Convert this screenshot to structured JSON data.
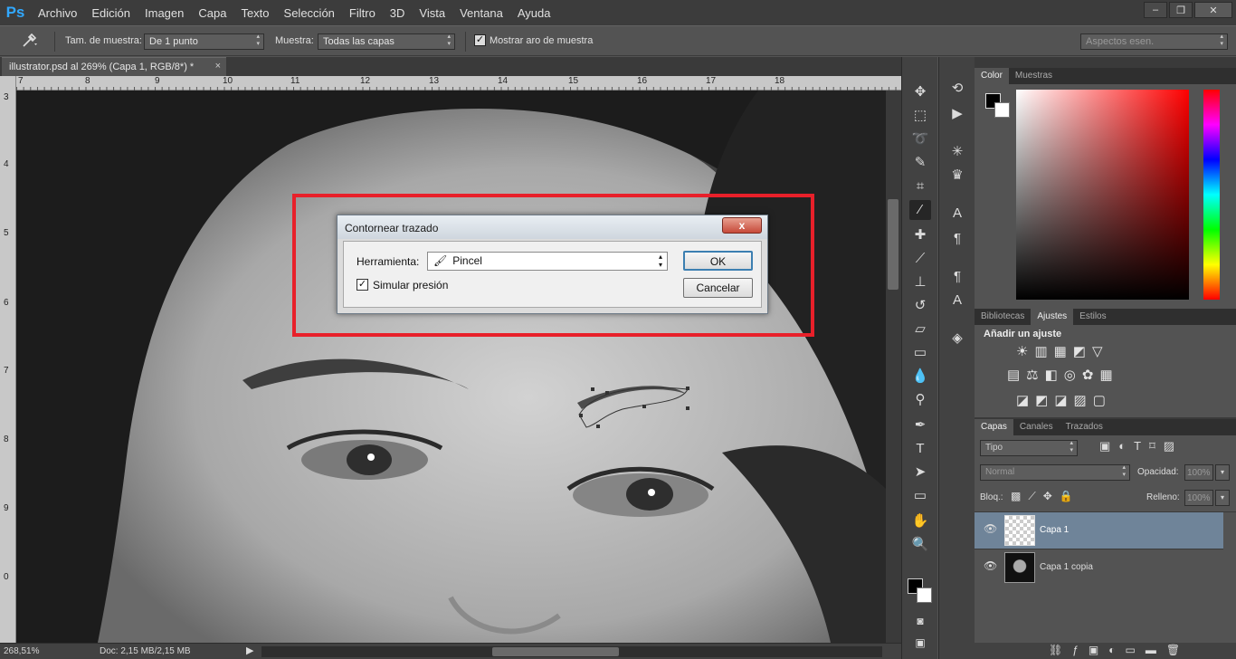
{
  "app": {
    "logo": "Ps"
  },
  "menu": [
    "Archivo",
    "Edición",
    "Imagen",
    "Capa",
    "Texto",
    "Selección",
    "Filtro",
    "3D",
    "Vista",
    "Ventana",
    "Ayuda"
  ],
  "window_controls": [
    "–",
    "❐",
    "✕"
  ],
  "options": {
    "sample_size_label": "Tam. de muestra:",
    "sample_size_value": "De 1 punto",
    "sample_label": "Muestra:",
    "sample_value": "Todas las capas",
    "show_ring_label": "Mostrar aro de muestra",
    "workspace": "Aspectos esen."
  },
  "document": {
    "tab": "illustrator.psd al 269% (Capa 1, RGB/8*) *",
    "zoom": "268,51%",
    "doc_info": "Doc: 2,15 MB/2,15 MB"
  },
  "rulers": {
    "h": [
      "7",
      "8",
      "9",
      "10",
      "11",
      "12",
      "13",
      "14",
      "15",
      "16",
      "17",
      "18"
    ],
    "v": [
      "3",
      "4",
      "5",
      "6",
      "7",
      "8",
      "9",
      "0"
    ]
  },
  "dialog": {
    "title": "Contornear trazado",
    "close": "x",
    "tool_label": "Herramienta:",
    "tool_value": "Pincel",
    "simulate_label": "Simular presión",
    "simulate_checked": true,
    "ok": "OK",
    "cancel": "Cancelar"
  },
  "panels": {
    "color_tabs": [
      "Color",
      "Muestras"
    ],
    "adjust_tabs": [
      "Bibliotecas",
      "Ajustes",
      "Estilos"
    ],
    "adjust_title": "Añadir un ajuste",
    "layers_tabs": [
      "Capas",
      "Canales",
      "Trazados"
    ],
    "filter_kind": "Tipo",
    "blend_mode": "Normal",
    "opacity_label": "Opacidad:",
    "opacity_value": "100%",
    "lock_label": "Bloq.:",
    "fill_label": "Relleno:",
    "fill_value": "100%",
    "layers": [
      {
        "name": "Capa 1",
        "selected": true
      },
      {
        "name": "Capa 1 copia",
        "selected": false
      }
    ]
  },
  "colors": {
    "accent_red": "#e8202a",
    "layer_selected": "#6f8499"
  }
}
